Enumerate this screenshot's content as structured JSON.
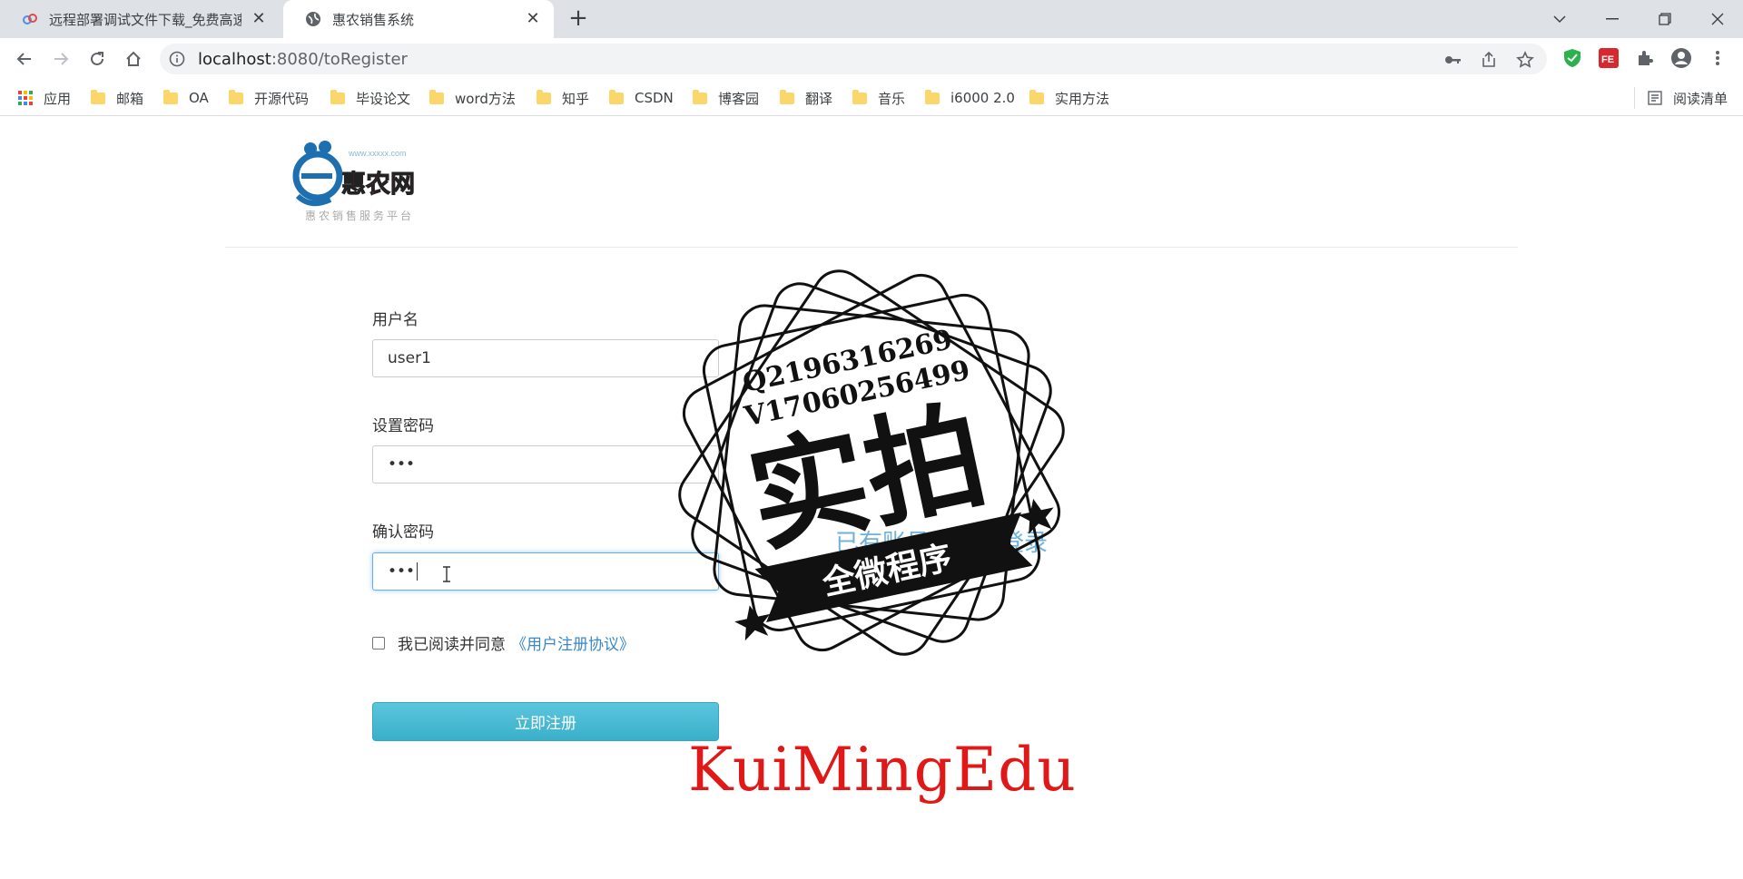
{
  "tabs": [
    {
      "title": "远程部署调试文件下载_免费高速",
      "active": false
    },
    {
      "title": "惠农销售系统",
      "active": true
    }
  ],
  "address": {
    "host": "localhost",
    "path": ":8080/toRegister"
  },
  "bookmarks": [
    {
      "label": "应用",
      "icon": "apps-icon"
    },
    {
      "label": "邮箱",
      "icon": "folder-icon"
    },
    {
      "label": "OA",
      "icon": "folder-icon"
    },
    {
      "label": "开源代码",
      "icon": "folder-icon"
    },
    {
      "label": "毕设论文",
      "icon": "folder-icon"
    },
    {
      "label": "word方法",
      "icon": "folder-icon"
    },
    {
      "label": "知乎",
      "icon": "folder-icon"
    },
    {
      "label": "CSDN",
      "icon": "folder-icon"
    },
    {
      "label": "博客园",
      "icon": "folder-icon"
    },
    {
      "label": "翻译",
      "icon": "folder-icon"
    },
    {
      "label": "音乐",
      "icon": "folder-icon"
    },
    {
      "label": "i6000 2.0",
      "icon": "folder-icon"
    },
    {
      "label": "实用方法",
      "icon": "folder-icon"
    }
  ],
  "reading_list": "阅读清单",
  "logo": {
    "name": "惠农网",
    "site": "www.xxxxx.com",
    "slogan": "惠农销售服务平台"
  },
  "form": {
    "username_label": "用户名",
    "username_value": "user1",
    "password_label": "设置密码",
    "password_value": "•••",
    "confirm_label": "确认密码",
    "confirm_value": "•••",
    "agree_text": "我已阅读并同意",
    "agree_link": "《用户注册协议》",
    "submit_label": "立即注册",
    "login_link": "已有账号？立即登录"
  },
  "stamp": {
    "line1": "Q2196316269",
    "line2": "V17060256499",
    "big": "实拍",
    "banner": "全微程序"
  },
  "watermark": "KuiMingEdu",
  "colors": {
    "accent": "#3aafca",
    "link": "#3a88c7",
    "watermark": "#e01818"
  }
}
